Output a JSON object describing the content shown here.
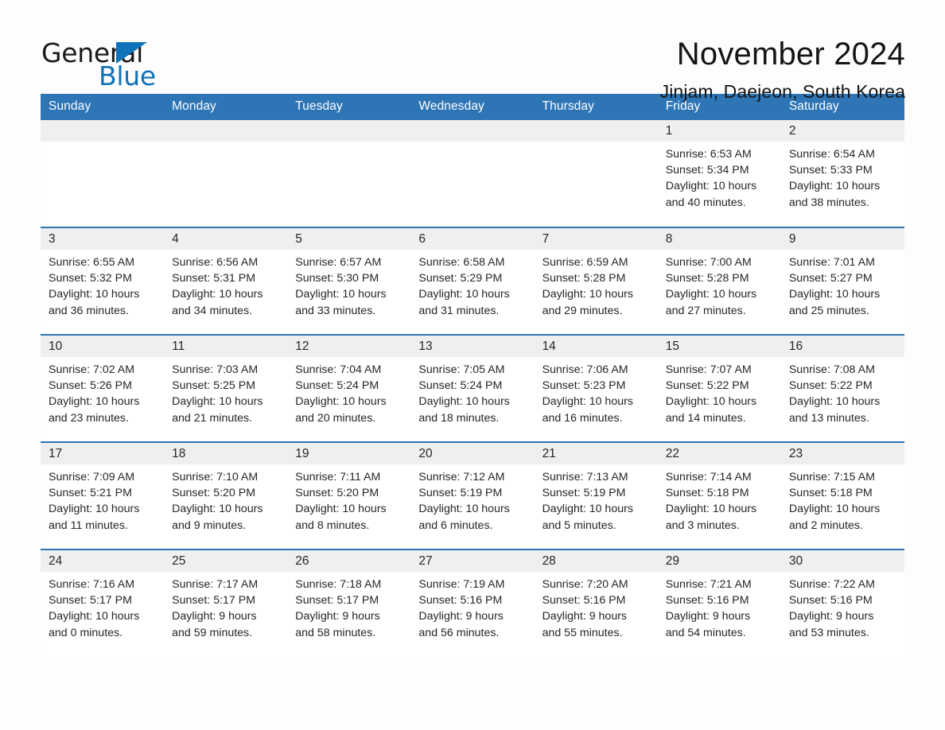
{
  "brand": {
    "name_part1": "General",
    "name_part2": "Blue",
    "triangle_icon": "blue-triangle-icon",
    "accent_color": "#1072b8"
  },
  "header": {
    "month_title": "November 2024",
    "location": "Jinjam, Daejeon, South Korea"
  },
  "calendar": {
    "header_color": "#2e75b6",
    "daynum_band_color": "#efefef",
    "weekday_headers": [
      "Sunday",
      "Monday",
      "Tuesday",
      "Wednesday",
      "Thursday",
      "Friday",
      "Saturday"
    ],
    "weeks": [
      [
        {
          "day": "",
          "empty": true,
          "sunrise": "",
          "sunset": "",
          "daylight_line1": "",
          "daylight_line2": ""
        },
        {
          "day": "",
          "empty": true,
          "sunrise": "",
          "sunset": "",
          "daylight_line1": "",
          "daylight_line2": ""
        },
        {
          "day": "",
          "empty": true,
          "sunrise": "",
          "sunset": "",
          "daylight_line1": "",
          "daylight_line2": ""
        },
        {
          "day": "",
          "empty": true,
          "sunrise": "",
          "sunset": "",
          "daylight_line1": "",
          "daylight_line2": ""
        },
        {
          "day": "",
          "empty": true,
          "sunrise": "",
          "sunset": "",
          "daylight_line1": "",
          "daylight_line2": ""
        },
        {
          "day": "1",
          "empty": false,
          "sunrise": "Sunrise: 6:53 AM",
          "sunset": "Sunset: 5:34 PM",
          "daylight_line1": "Daylight: 10 hours",
          "daylight_line2": "and 40 minutes."
        },
        {
          "day": "2",
          "empty": false,
          "sunrise": "Sunrise: 6:54 AM",
          "sunset": "Sunset: 5:33 PM",
          "daylight_line1": "Daylight: 10 hours",
          "daylight_line2": "and 38 minutes."
        }
      ],
      [
        {
          "day": "3",
          "empty": false,
          "sunrise": "Sunrise: 6:55 AM",
          "sunset": "Sunset: 5:32 PM",
          "daylight_line1": "Daylight: 10 hours",
          "daylight_line2": "and 36 minutes."
        },
        {
          "day": "4",
          "empty": false,
          "sunrise": "Sunrise: 6:56 AM",
          "sunset": "Sunset: 5:31 PM",
          "daylight_line1": "Daylight: 10 hours",
          "daylight_line2": "and 34 minutes."
        },
        {
          "day": "5",
          "empty": false,
          "sunrise": "Sunrise: 6:57 AM",
          "sunset": "Sunset: 5:30 PM",
          "daylight_line1": "Daylight: 10 hours",
          "daylight_line2": "and 33 minutes."
        },
        {
          "day": "6",
          "empty": false,
          "sunrise": "Sunrise: 6:58 AM",
          "sunset": "Sunset: 5:29 PM",
          "daylight_line1": "Daylight: 10 hours",
          "daylight_line2": "and 31 minutes."
        },
        {
          "day": "7",
          "empty": false,
          "sunrise": "Sunrise: 6:59 AM",
          "sunset": "Sunset: 5:28 PM",
          "daylight_line1": "Daylight: 10 hours",
          "daylight_line2": "and 29 minutes."
        },
        {
          "day": "8",
          "empty": false,
          "sunrise": "Sunrise: 7:00 AM",
          "sunset": "Sunset: 5:28 PM",
          "daylight_line1": "Daylight: 10 hours",
          "daylight_line2": "and 27 minutes."
        },
        {
          "day": "9",
          "empty": false,
          "sunrise": "Sunrise: 7:01 AM",
          "sunset": "Sunset: 5:27 PM",
          "daylight_line1": "Daylight: 10 hours",
          "daylight_line2": "and 25 minutes."
        }
      ],
      [
        {
          "day": "10",
          "empty": false,
          "sunrise": "Sunrise: 7:02 AM",
          "sunset": "Sunset: 5:26 PM",
          "daylight_line1": "Daylight: 10 hours",
          "daylight_line2": "and 23 minutes."
        },
        {
          "day": "11",
          "empty": false,
          "sunrise": "Sunrise: 7:03 AM",
          "sunset": "Sunset: 5:25 PM",
          "daylight_line1": "Daylight: 10 hours",
          "daylight_line2": "and 21 minutes."
        },
        {
          "day": "12",
          "empty": false,
          "sunrise": "Sunrise: 7:04 AM",
          "sunset": "Sunset: 5:24 PM",
          "daylight_line1": "Daylight: 10 hours",
          "daylight_line2": "and 20 minutes."
        },
        {
          "day": "13",
          "empty": false,
          "sunrise": "Sunrise: 7:05 AM",
          "sunset": "Sunset: 5:24 PM",
          "daylight_line1": "Daylight: 10 hours",
          "daylight_line2": "and 18 minutes."
        },
        {
          "day": "14",
          "empty": false,
          "sunrise": "Sunrise: 7:06 AM",
          "sunset": "Sunset: 5:23 PM",
          "daylight_line1": "Daylight: 10 hours",
          "daylight_line2": "and 16 minutes."
        },
        {
          "day": "15",
          "empty": false,
          "sunrise": "Sunrise: 7:07 AM",
          "sunset": "Sunset: 5:22 PM",
          "daylight_line1": "Daylight: 10 hours",
          "daylight_line2": "and 14 minutes."
        },
        {
          "day": "16",
          "empty": false,
          "sunrise": "Sunrise: 7:08 AM",
          "sunset": "Sunset: 5:22 PM",
          "daylight_line1": "Daylight: 10 hours",
          "daylight_line2": "and 13 minutes."
        }
      ],
      [
        {
          "day": "17",
          "empty": false,
          "sunrise": "Sunrise: 7:09 AM",
          "sunset": "Sunset: 5:21 PM",
          "daylight_line1": "Daylight: 10 hours",
          "daylight_line2": "and 11 minutes."
        },
        {
          "day": "18",
          "empty": false,
          "sunrise": "Sunrise: 7:10 AM",
          "sunset": "Sunset: 5:20 PM",
          "daylight_line1": "Daylight: 10 hours",
          "daylight_line2": "and 9 minutes."
        },
        {
          "day": "19",
          "empty": false,
          "sunrise": "Sunrise: 7:11 AM",
          "sunset": "Sunset: 5:20 PM",
          "daylight_line1": "Daylight: 10 hours",
          "daylight_line2": "and 8 minutes."
        },
        {
          "day": "20",
          "empty": false,
          "sunrise": "Sunrise: 7:12 AM",
          "sunset": "Sunset: 5:19 PM",
          "daylight_line1": "Daylight: 10 hours",
          "daylight_line2": "and 6 minutes."
        },
        {
          "day": "21",
          "empty": false,
          "sunrise": "Sunrise: 7:13 AM",
          "sunset": "Sunset: 5:19 PM",
          "daylight_line1": "Daylight: 10 hours",
          "daylight_line2": "and 5 minutes."
        },
        {
          "day": "22",
          "empty": false,
          "sunrise": "Sunrise: 7:14 AM",
          "sunset": "Sunset: 5:18 PM",
          "daylight_line1": "Daylight: 10 hours",
          "daylight_line2": "and 3 minutes."
        },
        {
          "day": "23",
          "empty": false,
          "sunrise": "Sunrise: 7:15 AM",
          "sunset": "Sunset: 5:18 PM",
          "daylight_line1": "Daylight: 10 hours",
          "daylight_line2": "and 2 minutes."
        }
      ],
      [
        {
          "day": "24",
          "empty": false,
          "sunrise": "Sunrise: 7:16 AM",
          "sunset": "Sunset: 5:17 PM",
          "daylight_line1": "Daylight: 10 hours",
          "daylight_line2": "and 0 minutes."
        },
        {
          "day": "25",
          "empty": false,
          "sunrise": "Sunrise: 7:17 AM",
          "sunset": "Sunset: 5:17 PM",
          "daylight_line1": "Daylight: 9 hours",
          "daylight_line2": "and 59 minutes."
        },
        {
          "day": "26",
          "empty": false,
          "sunrise": "Sunrise: 7:18 AM",
          "sunset": "Sunset: 5:17 PM",
          "daylight_line1": "Daylight: 9 hours",
          "daylight_line2": "and 58 minutes."
        },
        {
          "day": "27",
          "empty": false,
          "sunrise": "Sunrise: 7:19 AM",
          "sunset": "Sunset: 5:16 PM",
          "daylight_line1": "Daylight: 9 hours",
          "daylight_line2": "and 56 minutes."
        },
        {
          "day": "28",
          "empty": false,
          "sunrise": "Sunrise: 7:20 AM",
          "sunset": "Sunset: 5:16 PM",
          "daylight_line1": "Daylight: 9 hours",
          "daylight_line2": "and 55 minutes."
        },
        {
          "day": "29",
          "empty": false,
          "sunrise": "Sunrise: 7:21 AM",
          "sunset": "Sunset: 5:16 PM",
          "daylight_line1": "Daylight: 9 hours",
          "daylight_line2": "and 54 minutes."
        },
        {
          "day": "30",
          "empty": false,
          "sunrise": "Sunrise: 7:22 AM",
          "sunset": "Sunset: 5:16 PM",
          "daylight_line1": "Daylight: 9 hours",
          "daylight_line2": "and 53 minutes."
        }
      ]
    ]
  }
}
